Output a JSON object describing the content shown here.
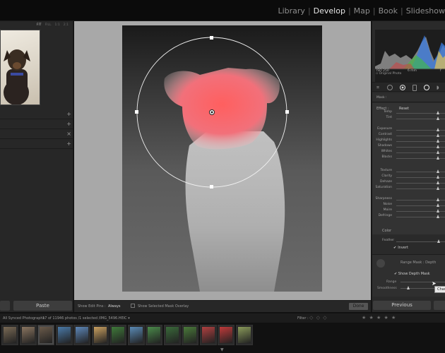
{
  "modules": [
    "Library",
    "Develop",
    "Map",
    "Book",
    "Slideshow"
  ],
  "active_module": "Develop",
  "navigator": {
    "tabs": [
      "FIT",
      "FILL",
      "1:1",
      "2:1"
    ]
  },
  "left_panel": {
    "rows": [
      "+",
      "+",
      "×",
      "+"
    ],
    "paste_label": "Paste"
  },
  "toolbar": {
    "edit_pins_label": "Show Edit Pins :",
    "edit_pins_value": "Always",
    "overlay_label": "Show Selected Mask Overlay",
    "done_label": "Done"
  },
  "histogram": {
    "iso": "ISO 250",
    "focal": "6 mm",
    "aperture": "f",
    "original_label": "Original Photo"
  },
  "mask": {
    "label": "Mask :",
    "effect_label": "Effect :",
    "effect_value": "Reset"
  },
  "sliders": [
    {
      "label": "Temp",
      "pos": 0.85
    },
    {
      "label": "Tint",
      "pos": 0.85
    },
    {
      "label": "Exposure",
      "pos": 0.85
    },
    {
      "label": "Contrast",
      "pos": 0.85
    },
    {
      "label": "Highlights",
      "pos": 0.85
    },
    {
      "label": "Shadows",
      "pos": 0.85
    },
    {
      "label": "Whites",
      "pos": 0.85
    },
    {
      "label": "Blacks",
      "pos": 0.85
    },
    {
      "label": "Texture",
      "pos": 0.85
    },
    {
      "label": "Clarity",
      "pos": 0.85
    },
    {
      "label": "Dehaze",
      "pos": 0.85
    },
    {
      "label": "Saturation",
      "pos": 0.85
    },
    {
      "label": "Sharpness",
      "pos": 0.85
    },
    {
      "label": "Noise",
      "pos": 0.85
    },
    {
      "label": "Moire",
      "pos": 0.85
    },
    {
      "label": "Defringe",
      "pos": 0.85
    }
  ],
  "color_label": "Color",
  "feather_label": "Feather",
  "invert": {
    "check": "✔",
    "label": "Invert"
  },
  "range_mask": {
    "label": "Range Mask : Depth",
    "show_depth": "Show Depth Mask",
    "range_label": "Range",
    "smoothness_label": "Smoothness",
    "tooltip": "Chan"
  },
  "nav": {
    "previous_label": "Previous"
  },
  "filmbar": {
    "source": "All Synced Photographs",
    "count": "17 of 11946 photos /1 selected /IMG_5496.HEIC ▾",
    "filter_label": "Filter :",
    "stars": "★ ★ ★ ★ ★",
    "flags": "◇ ◇ ◇"
  },
  "filmstrip": {
    "thumbs": [
      "#7a6a55",
      "#8a7560",
      "#6a5a4a",
      "#4a7aa8",
      "#5d87b8",
      "#caa060",
      "#3f7a3a",
      "#5a8ab5",
      "#4a8a4a",
      "#3a6a3a",
      "#4a7a3a",
      "#b04040",
      "#c03a3a",
      "#8a9a5a"
    ],
    "selected_index": 2
  },
  "mask_overlay_color": "#ff5a5a"
}
